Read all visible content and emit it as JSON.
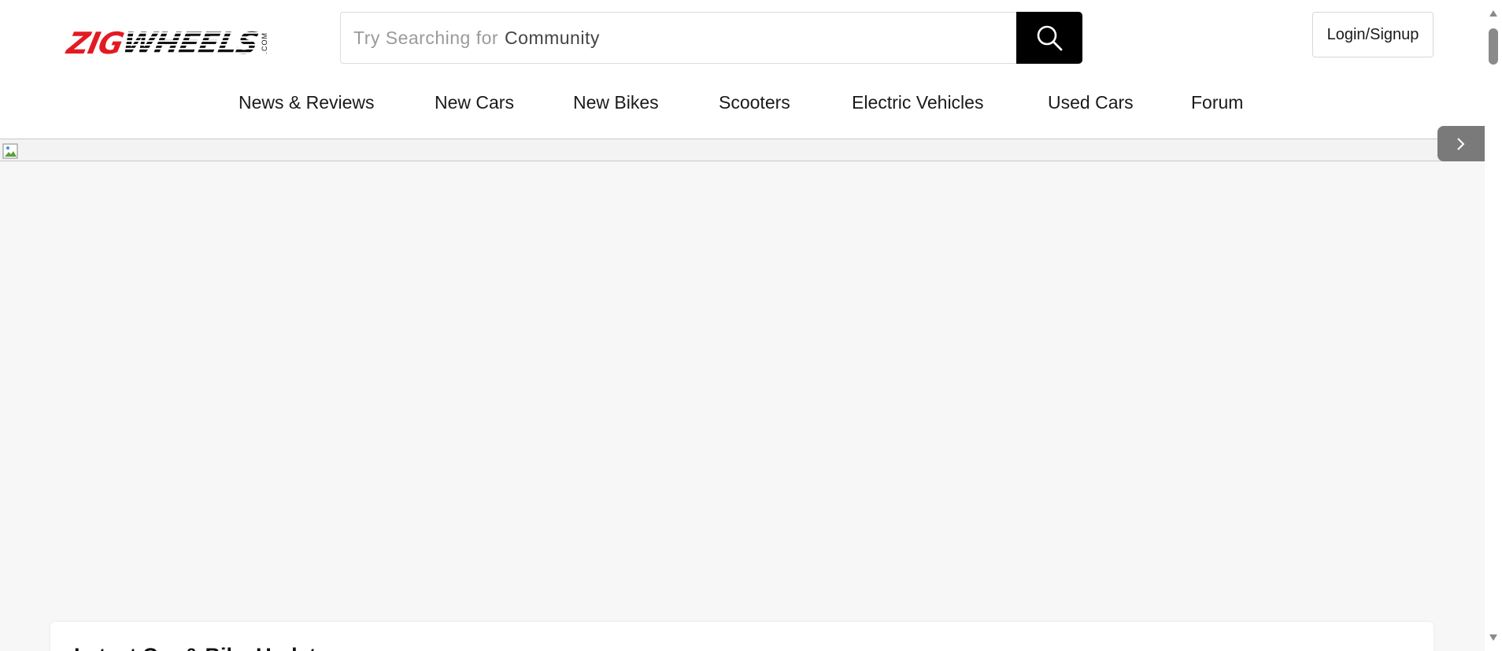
{
  "logo": {
    "zig": "ZIG",
    "wheels": "WHEELS",
    "com": ".COM",
    "brand_color": "#e21b23"
  },
  "search": {
    "placeholder": "Try Searching for",
    "rotating_term": "Community",
    "icon": "search-icon"
  },
  "header": {
    "login_label": "Login/Signup"
  },
  "nav": {
    "items": [
      {
        "label": "News & Reviews"
      },
      {
        "label": "New Cars"
      },
      {
        "label": "New Bikes"
      },
      {
        "label": "Scooters"
      },
      {
        "label": "Electric Vehicles"
      },
      {
        "label": "Used Cars"
      },
      {
        "label": "Forum"
      }
    ]
  },
  "banner": {
    "image_icon": "broken-image-icon",
    "next_icon": "chevron-right-icon"
  },
  "section": {
    "title": "Latest Car & Bike Updates"
  }
}
